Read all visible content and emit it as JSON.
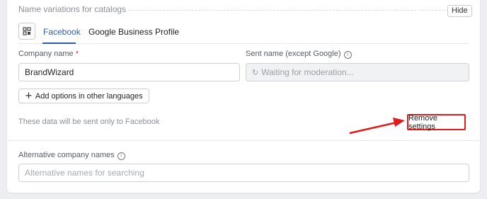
{
  "section": {
    "title": "Name variations for catalogs",
    "hide_label": "Hide"
  },
  "tabs": [
    {
      "label": "Facebook",
      "active": true
    },
    {
      "label": "Google Business Profile",
      "active": false
    }
  ],
  "company_name": {
    "label": "Company name",
    "required_mark": "*",
    "value": "BrandWizard"
  },
  "sent_name": {
    "label": "Sent name (except Google)",
    "info_glyph": "i",
    "value": "Waiting for moderation..."
  },
  "add_options_label": "Add options in other languages",
  "note": "These data will be sent only to Facebook",
  "remove_settings_label": "Remove settings",
  "alternative_names": {
    "label": "Alternative company names",
    "info_glyph": "i",
    "placeholder": "Alternative names for searching"
  },
  "colors": {
    "accent": "#2a5db0",
    "annotation_red": "#e01b1b"
  }
}
